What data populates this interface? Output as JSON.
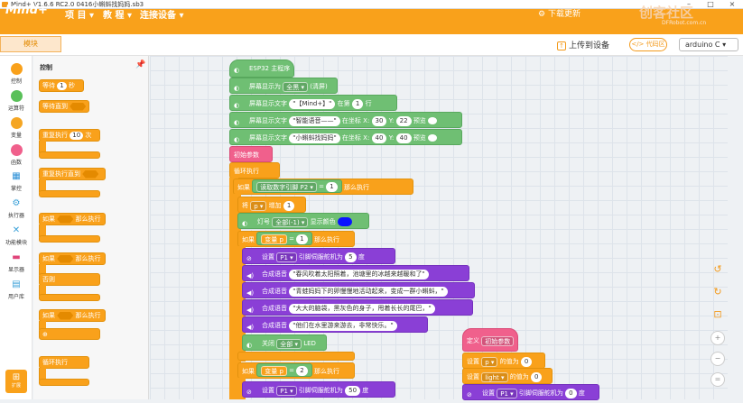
{
  "window": {
    "title": "Mind+ V1.6.6 RC2.0   0416小蝌蚪找妈妈.sb3"
  },
  "app": {
    "logo": "Mind+",
    "menus": [
      "项 目 ▾",
      "教 程 ▾",
      "连接设备 ▾"
    ],
    "download": "下载更新",
    "brand": "创客社区",
    "brand_sub": "DFRobot.com.cn",
    "accent": "#f9a11b"
  },
  "toolbar": {
    "tab": "模块",
    "upload": "上传到设备",
    "code_area": "代码区",
    "board": "arduino C"
  },
  "categories": [
    {
      "label": "控制",
      "color": "#f9a11b"
    },
    {
      "label": "运算符",
      "color": "#59c059"
    },
    {
      "label": "变量",
      "color": "#f5a623"
    },
    {
      "label": "函数",
      "color": "#f0608c"
    },
    {
      "label": "掌控",
      "icon": "board-icon"
    },
    {
      "label": "执行器",
      "icon": "actuator-icon"
    },
    {
      "label": "功能模块",
      "icon": "tools-icon"
    },
    {
      "label": "显示器",
      "icon": "display-icon"
    },
    {
      "label": "用户库",
      "icon": "library-icon"
    }
  ],
  "palette": {
    "title": "控制",
    "wait": "等待",
    "wait_val": "1",
    "wait_unit": "秒",
    "wait_until": "等待直到",
    "repeat": "重复执行",
    "repeat_val": "10",
    "repeat_unit": "次",
    "repeat_until": "重复执行直到",
    "if": "如果",
    "then": "那么执行",
    "else": "否则",
    "forever": "循环执行",
    "extend": "扩展"
  },
  "script": {
    "main": "ESP32 主程序",
    "s1a": "屏幕显示为",
    "s1b": "全黑",
    "s1c": "(清屏)",
    "s2a": "屏幕显示文字",
    "s2b": "\"【Mind+】\"",
    "s2c": "在第",
    "s2d": "1",
    "s2e": "行",
    "s3a": "屏幕显示文字",
    "s3b": "\"智能语音——\"",
    "s3c": "在坐标 X:",
    "s3d": "30",
    "s3e": "Y:",
    "s3f": "22",
    "s3g": "预览",
    "s4a": "屏幕显示文字",
    "s4b": "\"小蝌蚪找妈妈\"",
    "s4c": "在坐标 X:",
    "s4d": "40",
    "s4e": "Y:",
    "s4f": "40",
    "s4g": "预览",
    "init": "初始参数",
    "loop": "循环执行",
    "if1a": "如果",
    "if1b": "读取数字引脚",
    "if1c": "P2",
    "if1d": "=",
    "if1e": "1",
    "if1f": "那么执行",
    "inc_a": "将",
    "inc_b": "p",
    "inc_c": "增加",
    "inc_d": "1",
    "led_a": "灯号",
    "led_b": "全部(-1)",
    "led_c": "显示颜色",
    "if2a": "如果",
    "if2b": "变量 p",
    "if2c": "=",
    "if2d": "1",
    "if2e": "那么执行",
    "sv1a": "设置",
    "sv1b": "P1",
    "sv1c": "引脚伺服舵机为",
    "sv1d": "5",
    "sv1e": "度",
    "tts1a": "合成语音",
    "tts1": "\"春风吹着太阳照着，池塘里的冰越来越暖和了\"",
    "tts2a": "合成语音",
    "tts2": "\"青蛙妈妈下的卵慢慢地活动起来，变成一群小蝌蚪，\"",
    "tts3a": "合成语音",
    "tts3": "\"大大的脑袋，黑灰色的身子，甩着长长的尾巴，\"",
    "tts4a": "合成语音",
    "tts4": "\"他们在水里游来游去，非常快乐。\"",
    "off_a": "关闭",
    "off_b": "全部",
    "off_c": "LED",
    "if3a": "如果",
    "if3b": "变量 p",
    "if3c": "=",
    "if3d": "2",
    "if3e": "那么执行",
    "sv2a": "设置",
    "sv2b": "P1",
    "sv2c": "引脚伺服舵机为",
    "sv2d": "50",
    "sv2e": "度",
    "def_a": "定义",
    "def_b": "初始参数",
    "set1a": "设置",
    "set1b": "p",
    "set1c": "的值为",
    "set1d": "0",
    "set2a": "设置",
    "set2b": "light",
    "set2c": "的值为",
    "set2d": "0",
    "sv3a": "设置",
    "sv3b": "P1",
    "sv3c": "引脚伺服舵机为",
    "sv3d": "0",
    "sv3e": "度"
  },
  "colors": {
    "led": "#0a14ff"
  }
}
